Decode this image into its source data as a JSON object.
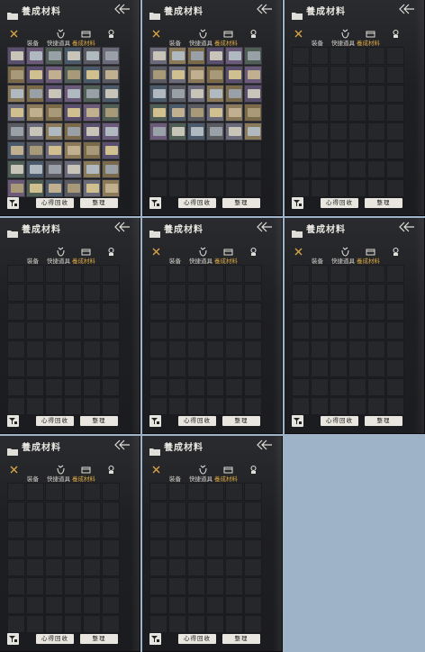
{
  "panel_title": "養成材料",
  "tabs": [
    {
      "label": "裝备"
    },
    {
      "label": "快捷道具"
    },
    {
      "label": "養成材料",
      "active": true
    }
  ],
  "buttons": {
    "recycle": "心得回收",
    "sort": "整理"
  },
  "icons": {
    "close": "close-x-icon",
    "armor": "armor-icon",
    "box": "chest-icon",
    "materials": "material-icon",
    "back": "back-arrow-icon",
    "filter": "filter-icon",
    "folder": "folder-icon"
  },
  "colors": {
    "accent": "#d8a544",
    "background": "#1e1f22",
    "slot": "#26272a",
    "button": "#e8e6df"
  },
  "panels_count": 8,
  "panels": [
    {
      "filled_rows": 8,
      "tab_close_visible": true
    },
    {
      "filled_rows": 5,
      "tab_close_visible": true
    },
    {
      "filled_rows": 0,
      "tab_close_visible": true
    },
    {
      "filled_rows": 0,
      "tab_close_visible": false
    },
    {
      "filled_rows": 0,
      "tab_close_visible": true
    },
    {
      "filled_rows": 0,
      "tab_close_visible": true
    },
    {
      "filled_rows": 0,
      "tab_close_visible": true
    },
    {
      "filled_rows": 0,
      "tab_close_visible": true
    }
  ]
}
